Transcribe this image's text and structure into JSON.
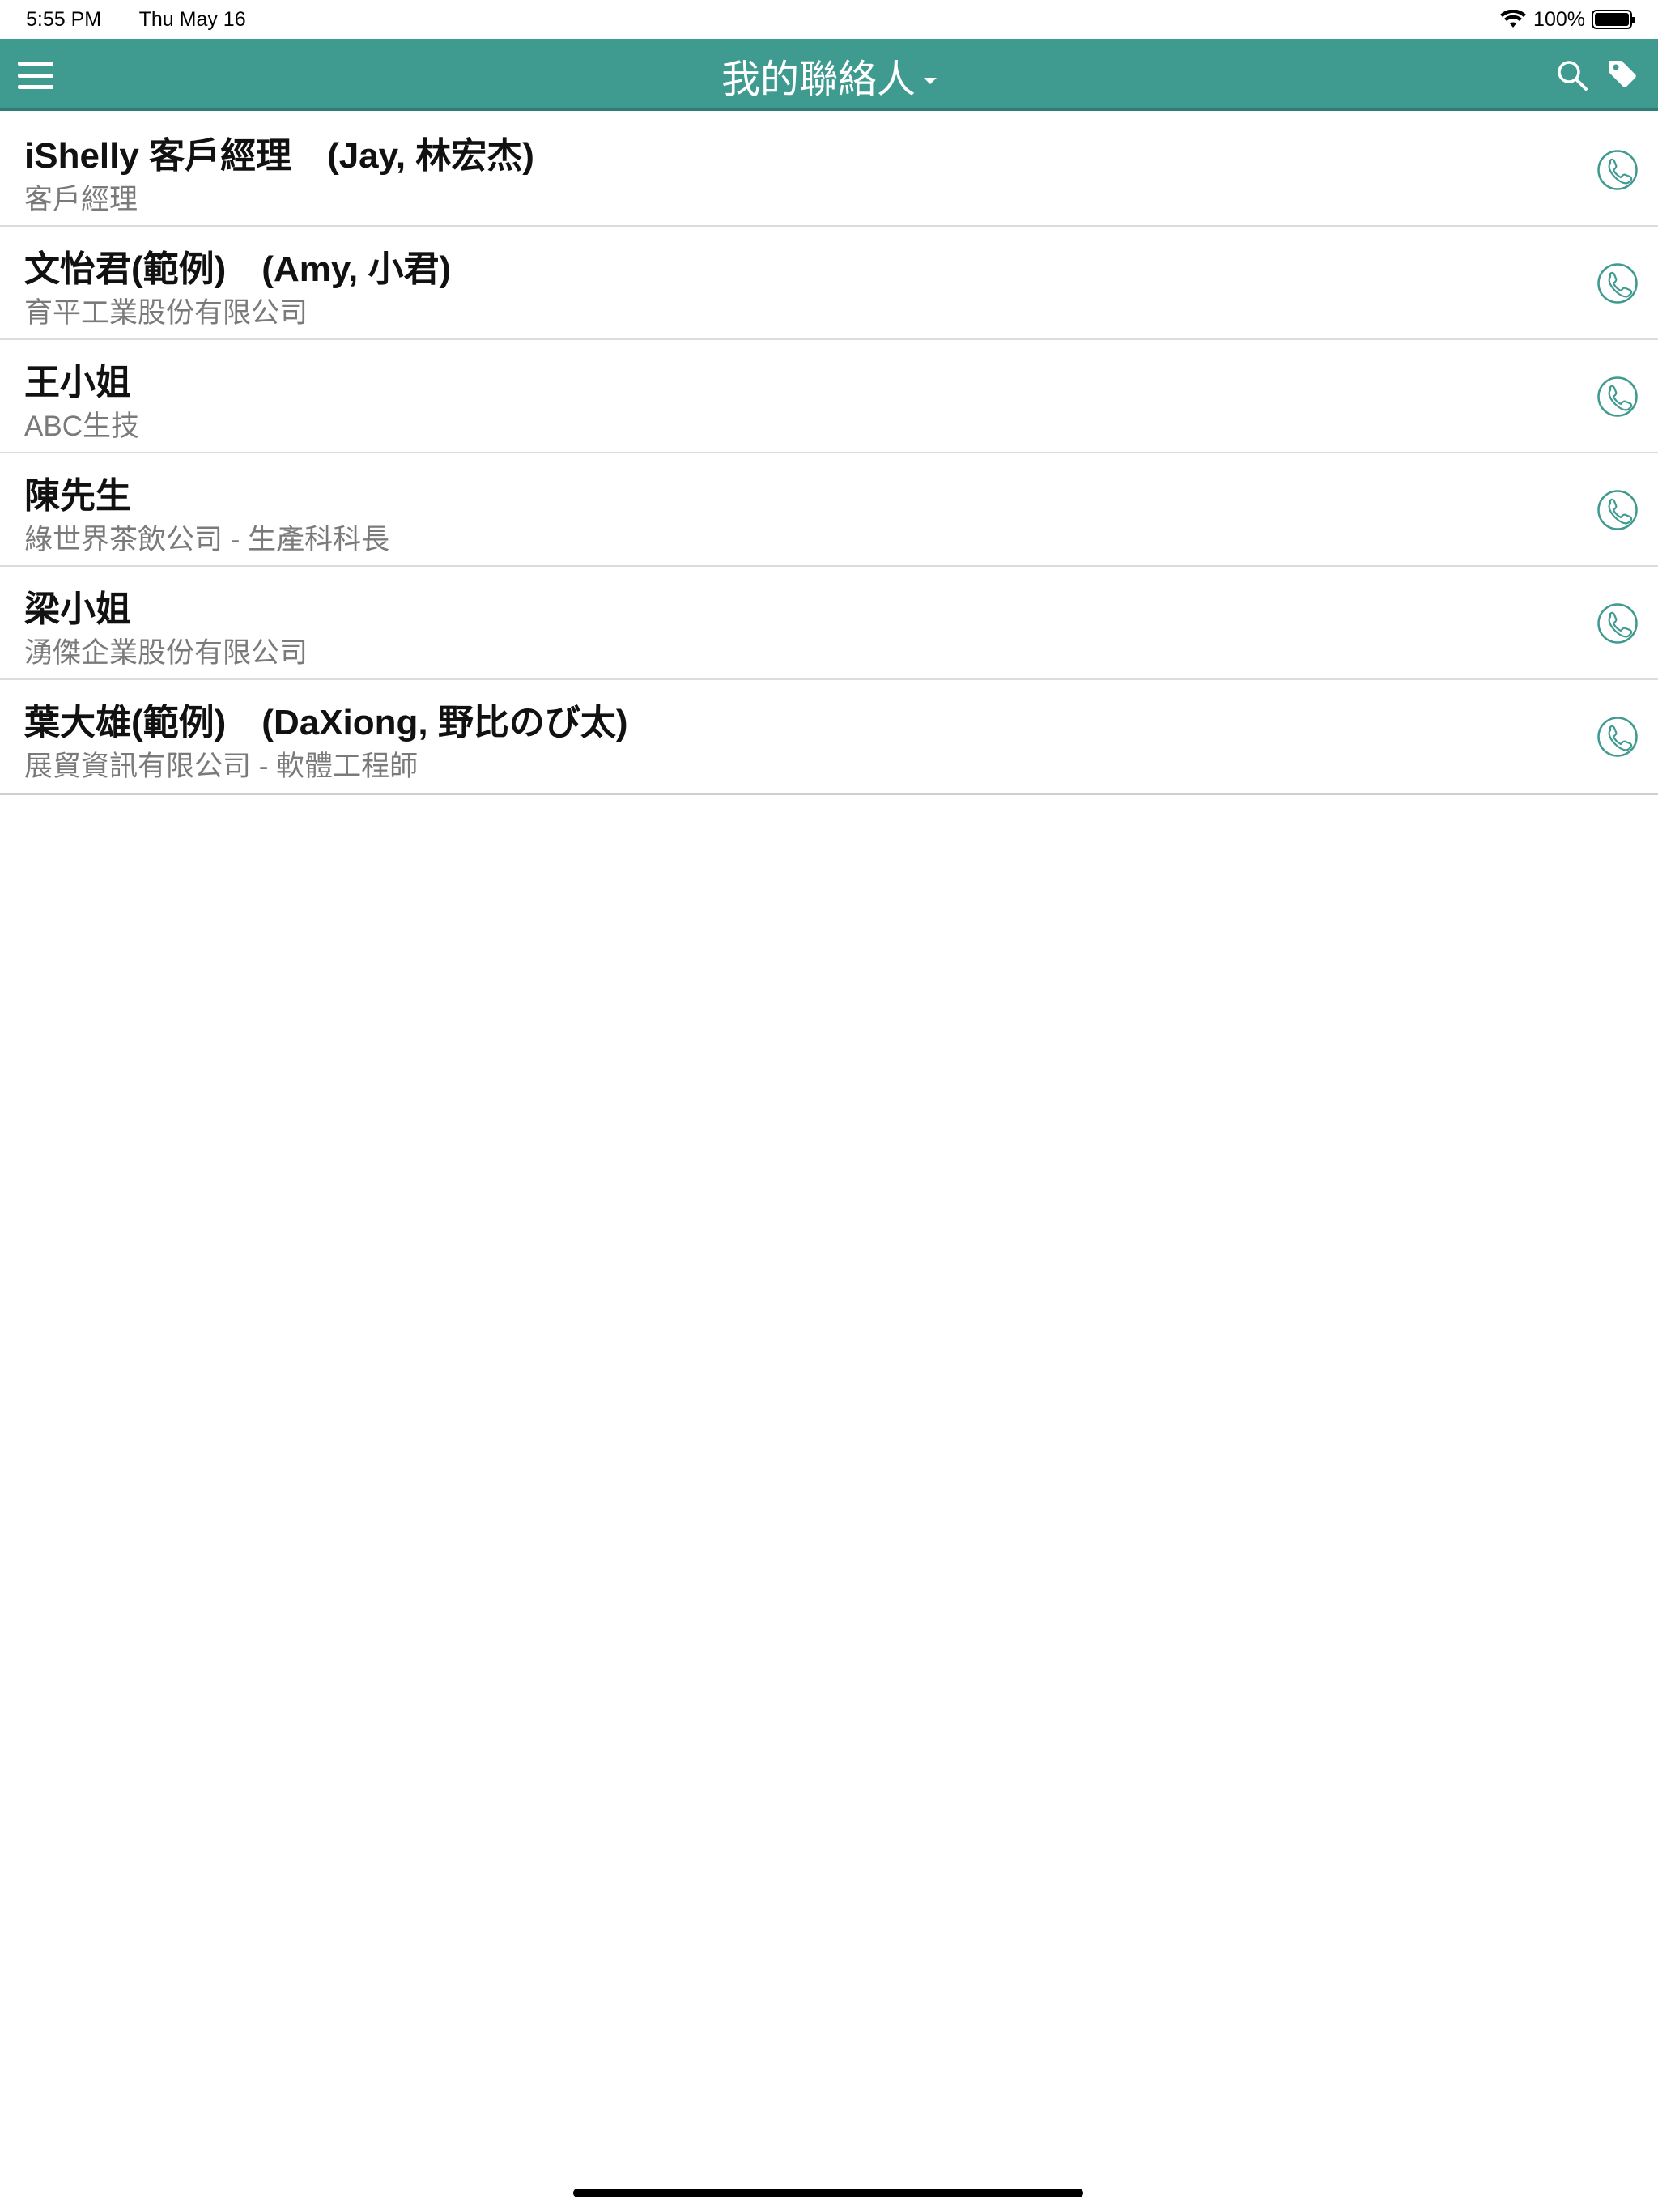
{
  "status_bar": {
    "time": "5:55 PM",
    "date": "Thu May 16",
    "battery": "100%"
  },
  "navbar": {
    "title": "我的聯絡人",
    "menu_icon": "hamburger-menu-icon",
    "search_icon": "search-icon",
    "tag_icon": "tag-icon"
  },
  "contacts": [
    {
      "name": "iShelly 客戶經理　(Jay, 林宏杰)",
      "subtitle": "客戶經理"
    },
    {
      "name": "文怡君(範例)　(Amy, 小君)",
      "subtitle": "育平工業股份有限公司"
    },
    {
      "name": "王小姐",
      "subtitle": "ABC生技"
    },
    {
      "name": "陳先生",
      "subtitle": "綠世界茶飲公司 - 生產科科長"
    },
    {
      "name": "梁小姐",
      "subtitle": "湧傑企業股份有限公司"
    },
    {
      "name": "葉大雄(範例)　(DaXiong, 野比のび太)",
      "subtitle": "展貿資訊有限公司 - 軟體工程師"
    }
  ],
  "colors": {
    "accent": "#3f9a90",
    "subtitle": "#7a7a7a",
    "divider": "#dcdcdc"
  }
}
